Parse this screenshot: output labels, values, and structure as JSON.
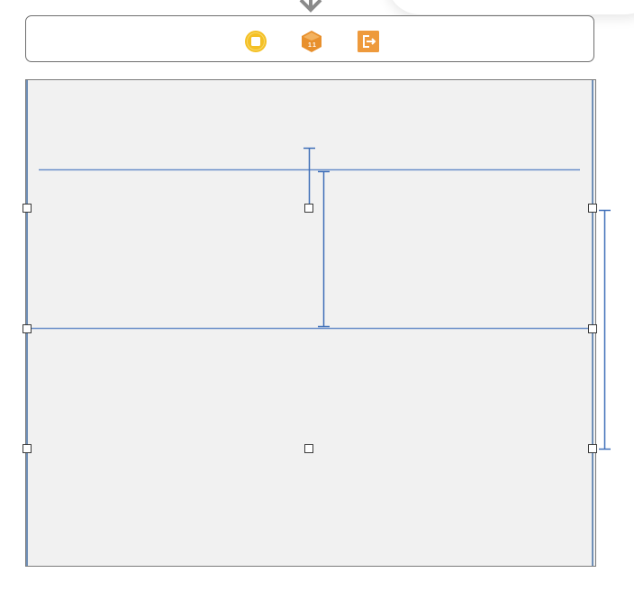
{
  "segue_icon": "segue-arrow-icon",
  "scene_dock": {
    "icons": [
      {
        "name": "view-controller-icon",
        "color": "#f4c025"
      },
      {
        "name": "first-responder-icon",
        "color": "#e8902d"
      },
      {
        "name": "exit-icon",
        "color": "#ee9a3c"
      }
    ]
  },
  "canvas": {
    "background": "#f1f1f1",
    "guide_color": "#6a8fc9",
    "selected_view_handles": [
      "top-left",
      "top-center",
      "top-right",
      "middle-left",
      "middle-right",
      "bottom-left",
      "bottom-center",
      "bottom-right"
    ]
  }
}
